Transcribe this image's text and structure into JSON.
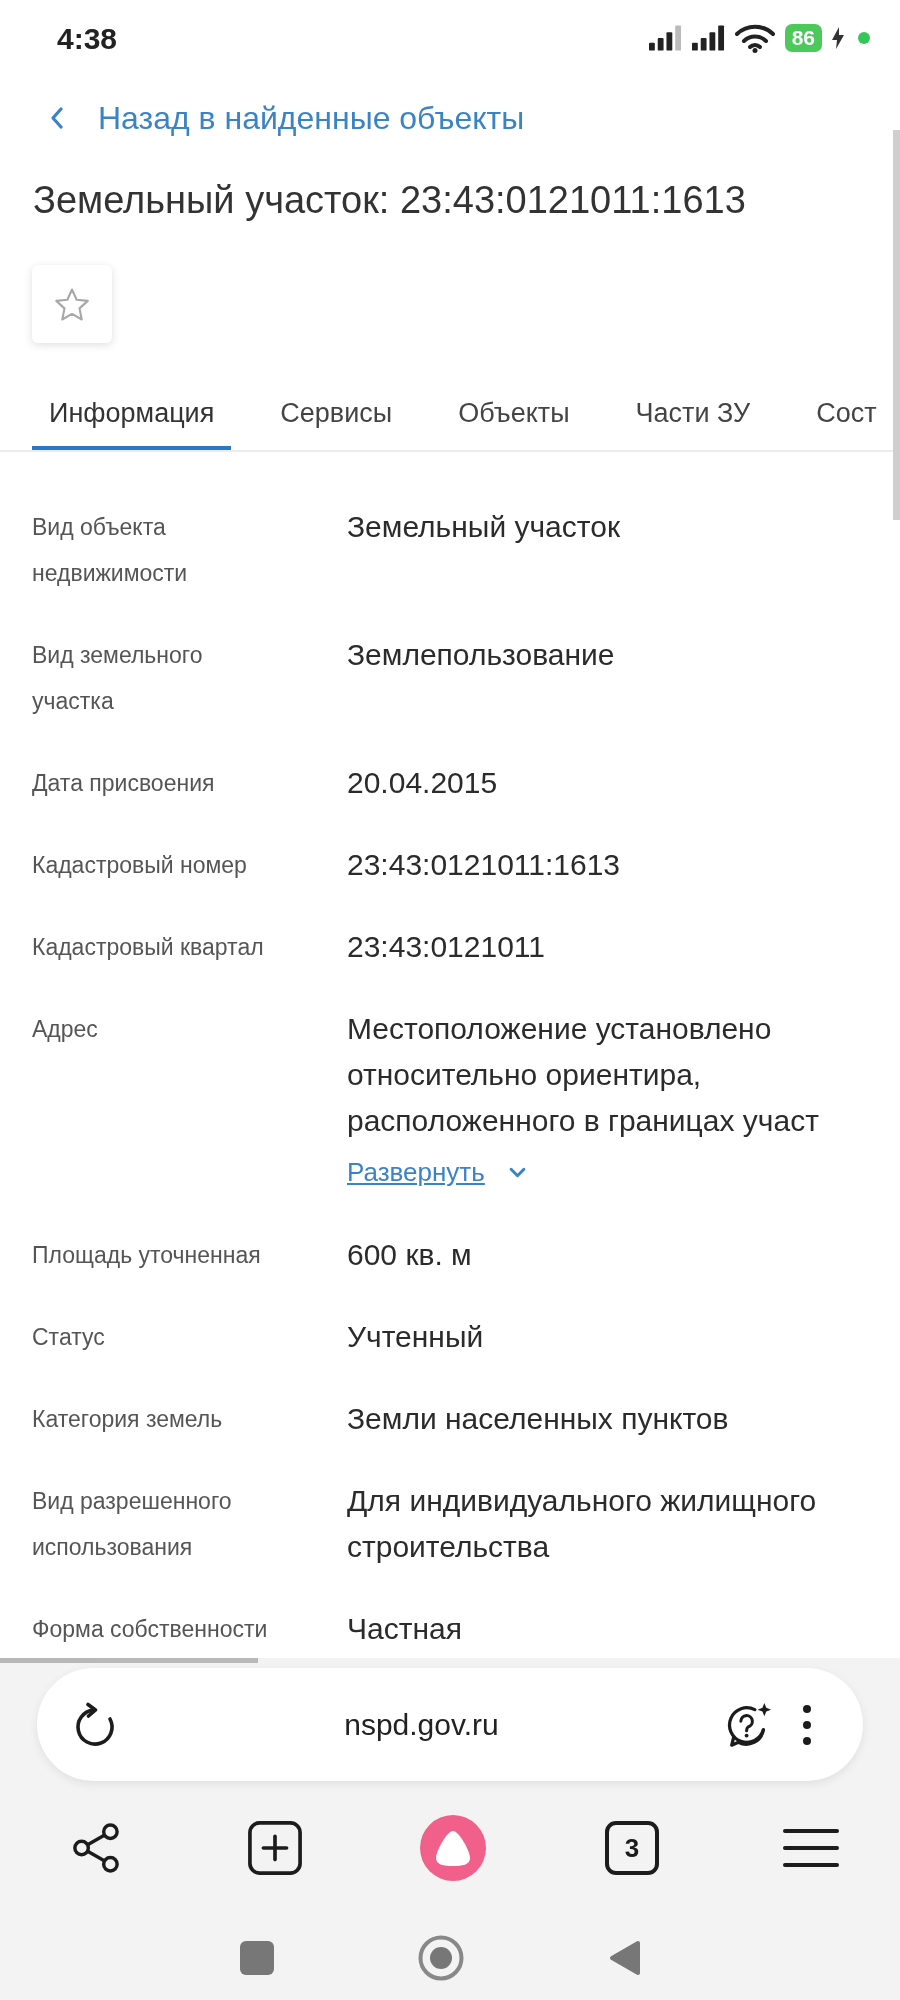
{
  "status_bar": {
    "time": "4:38",
    "battery": "86"
  },
  "back_link": {
    "label": "Назад в найденные объекты"
  },
  "title": "Земельный участок: 23:43:0121011:1613",
  "favorite": {
    "on": false
  },
  "tabs": [
    {
      "label": "Информация",
      "selected": true
    },
    {
      "label": "Сервисы",
      "selected": false
    },
    {
      "label": "Объекты",
      "selected": false
    },
    {
      "label": "Части ЗУ",
      "selected": false
    },
    {
      "label": "Сост",
      "selected": false
    }
  ],
  "fields": [
    {
      "kind": "text",
      "label": "Вид объекта недвижимости",
      "value": "Земельный участок"
    },
    {
      "kind": "text",
      "label": "Вид земельного участка",
      "value": "Землепользование"
    },
    {
      "kind": "text",
      "label": "Дата присвоения",
      "value": "20.04.2015"
    },
    {
      "kind": "text",
      "label": "Кадастровый номер",
      "value": "23:43:0121011:1613"
    },
    {
      "kind": "text",
      "label": "Кадастровый квартал",
      "value": "23:43:0121011"
    },
    {
      "kind": "expandable",
      "label": "Адрес",
      "value": "Местоположение установлено относительно ориентира, расположенного в границах участ",
      "expand_link": "Развернуть"
    },
    {
      "kind": "text",
      "label": "Площадь уточненная",
      "value": "600 кв. м"
    },
    {
      "kind": "text",
      "label": "Статус",
      "value": "Учтенный"
    },
    {
      "kind": "text",
      "label": "Категория земель",
      "value": "Земли населенных пунктов"
    },
    {
      "kind": "text",
      "label": "Вид разрешенного использования",
      "value": "Для индивидуального жилищного строительства"
    },
    {
      "kind": "text",
      "label": "Форма собственности",
      "value": "Частная"
    }
  ],
  "browser": {
    "url": "nspd.gov.ru",
    "tab_count": "3"
  }
}
